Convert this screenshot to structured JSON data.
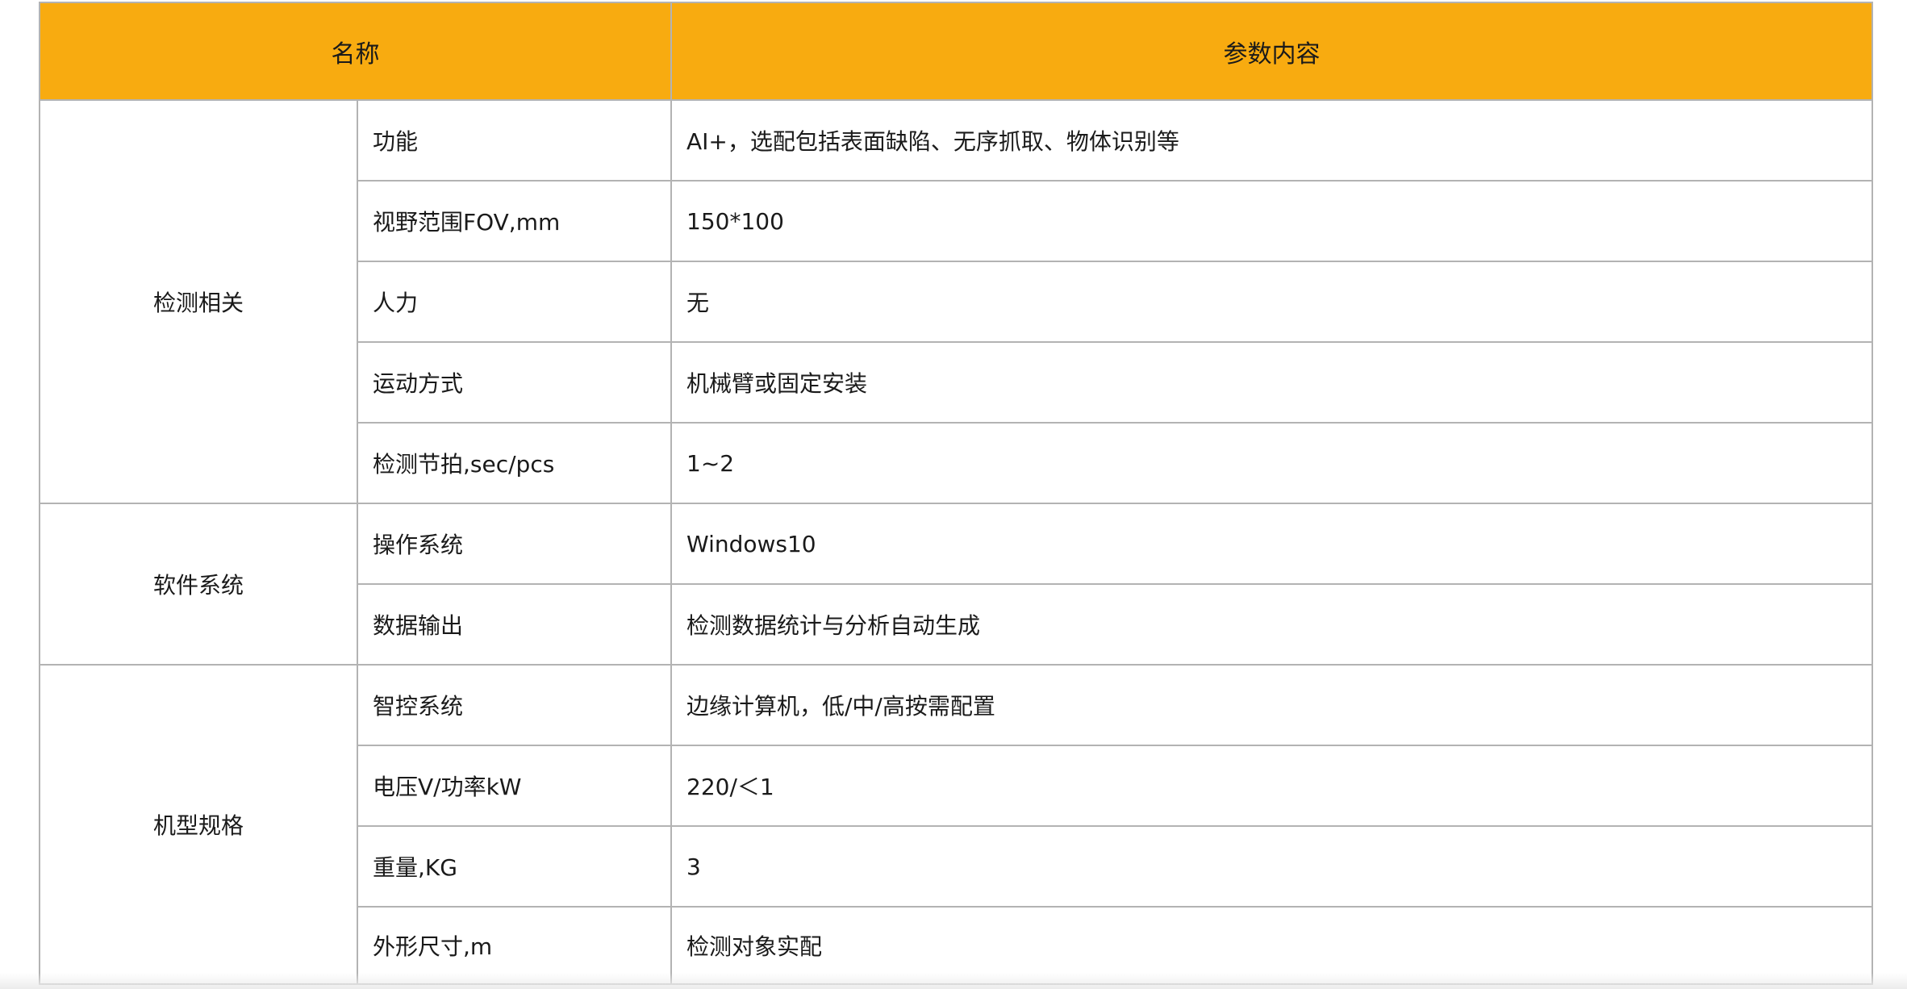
{
  "header": {
    "name_label": "名称",
    "content_label": "参数内容"
  },
  "groups": [
    {
      "label": "检测相关",
      "rows": [
        {
          "param": "功能",
          "value": "AI+，选配包括表面缺陷、无序抓取、物体识别等"
        },
        {
          "param": "视野范围FOV,mm",
          "value": "150*100"
        },
        {
          "param": "人力",
          "value": "无"
        },
        {
          "param": "运动方式",
          "value": "机械臂或固定安装"
        },
        {
          "param": "检测节拍,sec/pcs",
          "value": "1~2"
        }
      ]
    },
    {
      "label": "软件系统",
      "rows": [
        {
          "param": "操作系统",
          "value": "Windows10"
        },
        {
          "param": "数据输出",
          "value": "检测数据统计与分析自动生成"
        }
      ]
    },
    {
      "label": "机型规格",
      "rows": [
        {
          "param": "智控系统",
          "value": "边缘计算机，低/中/高按需配置"
        },
        {
          "param": "电压V/功率kW",
          "value": "220/＜1"
        },
        {
          "param": "重量,KG",
          "value": "3"
        },
        {
          "param": "外形尺寸,m",
          "value": "检测对象实配"
        }
      ]
    }
  ],
  "colors": {
    "header_bg": "#f8ab10",
    "border": "#b3b3b3"
  }
}
